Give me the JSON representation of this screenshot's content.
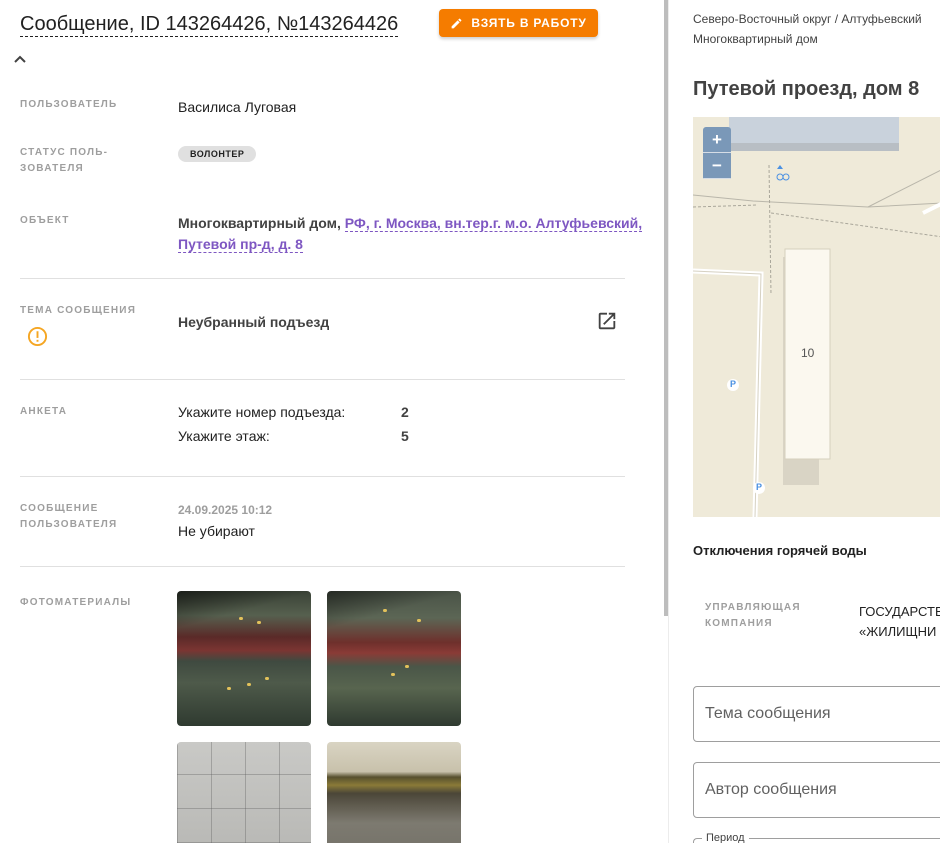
{
  "header": {
    "title": "Сообщение, ID 143264426, №143264426",
    "take_button_label": "ВЗЯТЬ В РАБОТУ"
  },
  "fields": {
    "user_label": "ПОЛЬЗОВАТЕЛЬ",
    "user_value": "Василиса Луговая",
    "status_label_line1": "СТАТУС ПОЛЬ-",
    "status_label_line2": "ЗОВАТЕЛЯ",
    "status_value": "ВОЛОНТЕР",
    "object_label": "ОБЪЕКТ",
    "object_type": "Многоквартирный дом,",
    "object_link_line1": "РФ, г. Москва, вн.тер.г. м.о. Алтуфьевский,",
    "object_link_line2": "Путевой пр-д, д. 8",
    "topic_label": "ТЕМА СООБЩЕНИЯ",
    "topic_value": "Неубранный подъезд",
    "survey_label": "АНКЕТА",
    "survey": [
      {
        "question": "Укажите номер подъезда:",
        "answer": "2"
      },
      {
        "question": "Укажите этаж:",
        "answer": "5"
      }
    ],
    "message_label_line1": "СООБЩЕНИЕ",
    "message_label_line2": "ПОЛЬЗОВАТЕЛЯ",
    "message_date": "24.09.2025 10:12",
    "message_text": "Не убирают",
    "photos_label": "ФОТОМАТЕРИАЛЫ"
  },
  "right": {
    "breadcrumb_line1": "Северо-Восточный округ / Алтуфьевский",
    "breadcrumb_line2": "Многоквартирный дом",
    "address": "Путевой проезд, дом 8",
    "map": {
      "building_number": "10",
      "parking_label": "P",
      "zoom_in": "+",
      "zoom_out": "−"
    },
    "hot_water_title": "Отключения горячей воды",
    "uk_label_line1": "УПРАВЛЯЮЩАЯ",
    "uk_label_line2": "КОМПАНИЯ",
    "uk_value_line1": "ГОСУДАРСТВ",
    "uk_value_line2": "«ЖИЛИЩНИ",
    "topic_placeholder": "Тема сообщения",
    "author_placeholder": "Автор сообщения",
    "period_label": "Период"
  },
  "colors": {
    "accent": "#f57c00",
    "link": "#7e57c2",
    "warning": "#f5a623"
  }
}
